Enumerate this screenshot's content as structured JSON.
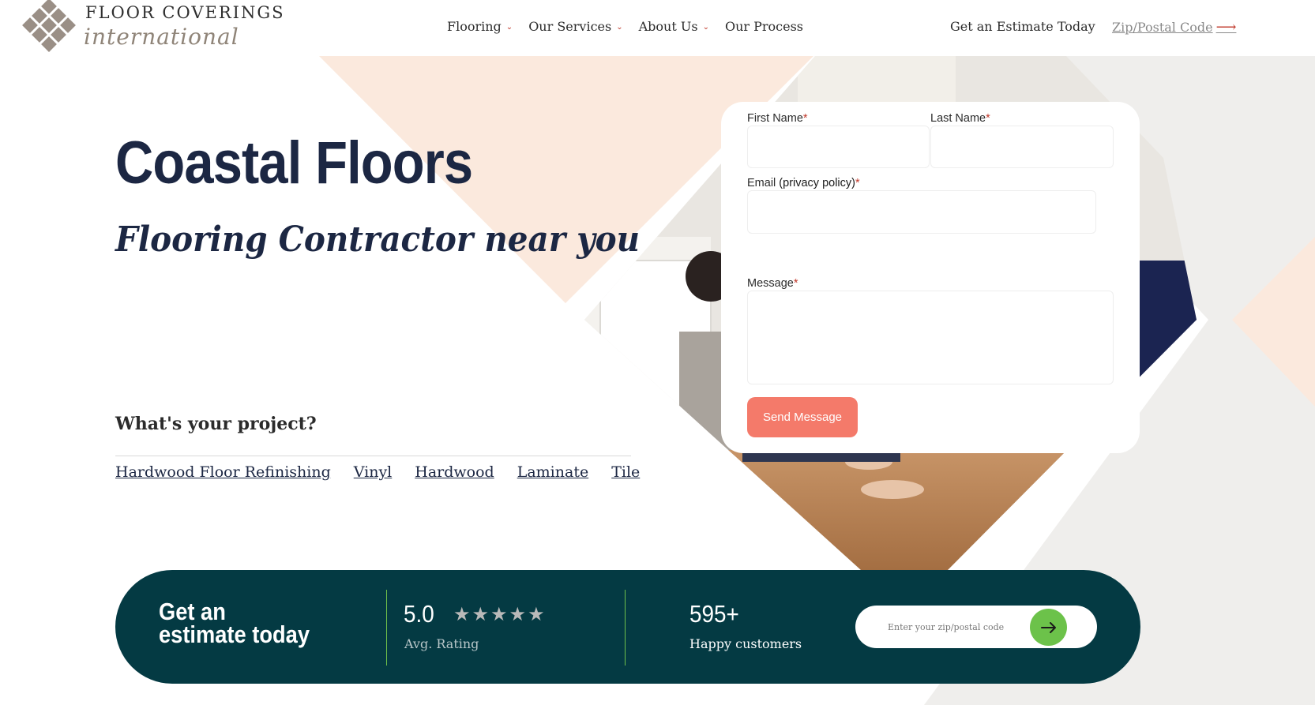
{
  "brand": {
    "line1": "FLOOR COVERINGS",
    "line2": "international",
    "color_mark": "#9a8f86"
  },
  "nav": {
    "items": [
      {
        "label": "Flooring",
        "has_dropdown": true
      },
      {
        "label": "Our Services",
        "has_dropdown": true
      },
      {
        "label": "About Us",
        "has_dropdown": true
      },
      {
        "label": "Our Process",
        "has_dropdown": false
      }
    ],
    "estimate_link": "Get an Estimate Today",
    "zip_link": "Zip/Postal Code"
  },
  "hero": {
    "title": "Coastal Floors",
    "subtitle": "Flooring Contractor near you",
    "project_question": "What's your project?",
    "project_links": [
      "Hardwood Floor Refinishing",
      "Vinyl",
      "Hardwood",
      "Laminate",
      "Tile"
    ]
  },
  "form": {
    "first_name_label": "First Name",
    "last_name_label": "Last Name",
    "email_label": "Email",
    "privacy_label": "(privacy policy)",
    "message_label": "Message",
    "required_mark": "*",
    "send_label": "Send Message",
    "first_name_value": "",
    "last_name_value": "",
    "email_value": "",
    "message_value": ""
  },
  "band": {
    "title": "Get an estimate today",
    "rating_value": "5.0",
    "stars": 5,
    "rating_label": "Avg. Rating",
    "customers_value": "595+",
    "customers_label": "Happy customers",
    "zip_placeholder": "Enter your zip/postal code"
  },
  "colors": {
    "navy": "#1c2743",
    "teal_band": "#043a43",
    "coral_button": "#f47a6a",
    "green_go": "#6cc24a",
    "peach": "#fbe9dd",
    "light_gray": "#efeeec",
    "required_red": "#c0392b"
  }
}
